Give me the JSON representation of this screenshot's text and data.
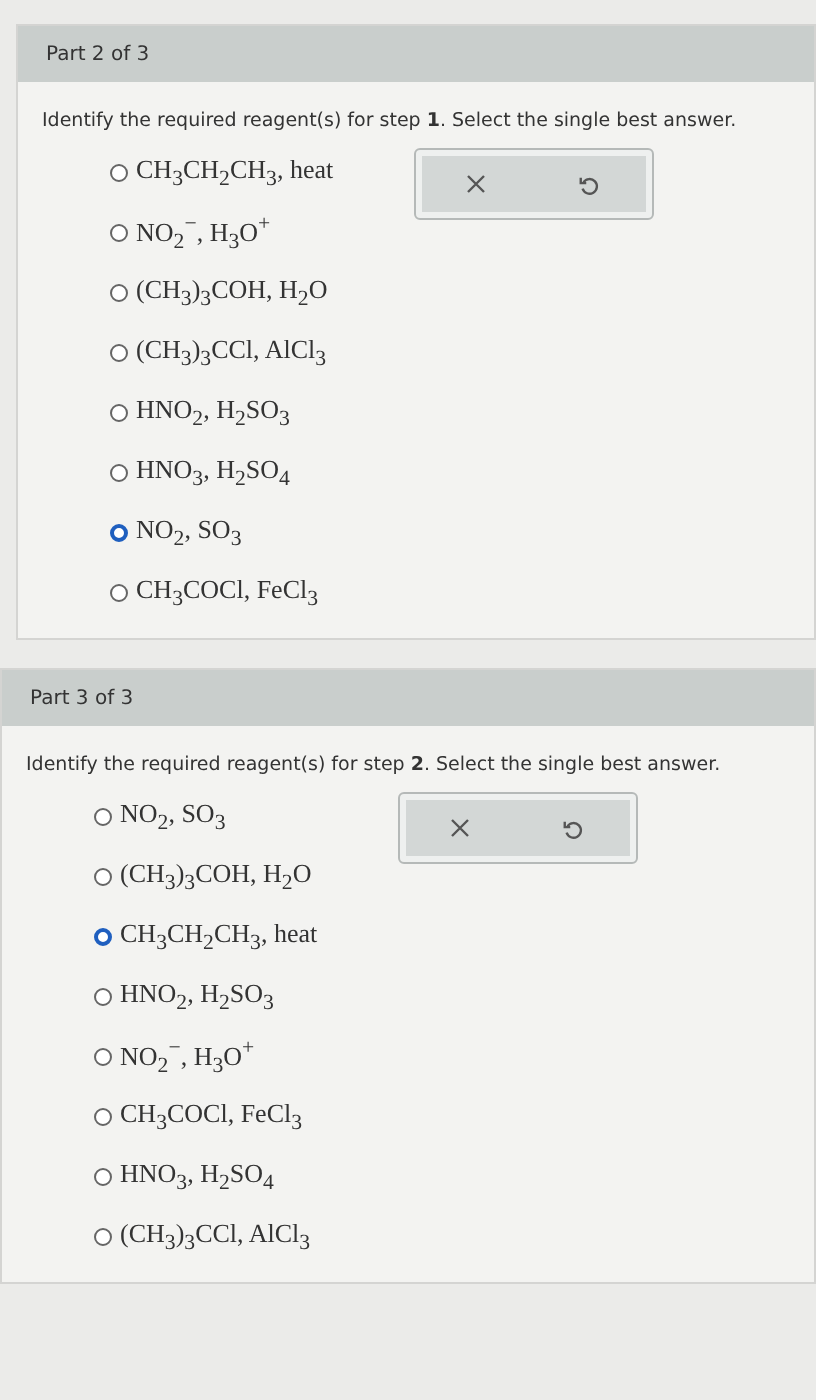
{
  "parts": [
    {
      "title": "Part 2 of 3",
      "prompt": "Identify the required reagent(s) for step **1**. Select the single best answer.",
      "options": [
        {
          "label": "CH$_{3}$CH$_{2}$CH$_{3}$, heat",
          "selected": false
        },
        {
          "label": "NO$_{2}$$^{−}$, H$_{3}$O$^{+}$",
          "selected": false
        },
        {
          "label": "(CH$_{3}$)$_{3}$COH, H$_{2}$O",
          "selected": false
        },
        {
          "label": "(CH$_{3}$)$_{3}$CCl, AlCl$_{3}$",
          "selected": false
        },
        {
          "label": "HNO$_{2}$, H$_{2}$SO$_{3}$",
          "selected": false
        },
        {
          "label": "HNO$_{3}$, H$_{2}$SO$_{4}$",
          "selected": false
        },
        {
          "label": "NO$_{2}$, SO$_{3}$",
          "selected": true
        },
        {
          "label": "CH$_{3}$COCl, FeCl$_{3}$",
          "selected": false
        }
      ]
    },
    {
      "title": "Part 3 of 3",
      "prompt": "Identify the required reagent(s) for step **2**. Select the single best answer.",
      "options": [
        {
          "label": "NO$_{2}$, SO$_{3}$",
          "selected": false
        },
        {
          "label": "(CH$_{3}$)$_{3}$COH, H$_{2}$O",
          "selected": false
        },
        {
          "label": "CH$_{3}$CH$_{2}$CH$_{3}$, heat",
          "selected": true
        },
        {
          "label": "HNO$_{2}$, H$_{2}$SO$_{3}$",
          "selected": false
        },
        {
          "label": "NO$_{2}$$^{−}$, H$_{3}$O$^{+}$",
          "selected": false
        },
        {
          "label": "CH$_{3}$COCl, FeCl$_{3}$",
          "selected": false
        },
        {
          "label": "HNO$_{3}$, H$_{2}$SO$_{4}$",
          "selected": false
        },
        {
          "label": "(CH$_{3}$)$_{3}$CCl, AlCl$_{3}$",
          "selected": false
        }
      ]
    }
  ]
}
